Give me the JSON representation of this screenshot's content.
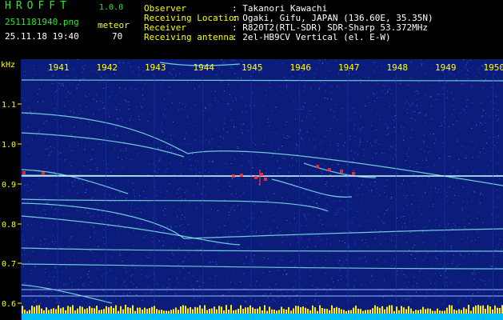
{
  "app": {
    "name": "HROFFT",
    "version": "1.0.0"
  },
  "file": {
    "name": "2511181940.png",
    "timestamp": "25.11.18 19:40"
  },
  "meteor": {
    "label": "meteor",
    "count": "70"
  },
  "info": [
    {
      "key": "Observer",
      "value": ": Takanori Kawachi"
    },
    {
      "key": "Receiving Location",
      "value": ": Ogaki, Gifu, JAPAN (136.60E, 35.35N)"
    },
    {
      "key": "Receiver",
      "value": ": R820T2(RTL-SDR) SDR-Sharp 53.372MHz"
    },
    {
      "key": "Receiving antenna",
      "value": ": 2el-HB9CV Vertical (el. E-W)"
    }
  ],
  "plot": {
    "unit_label": "kHz",
    "time_ticks": [
      "1941",
      "1942",
      "1943",
      "1944",
      "1945",
      "1946",
      "1947",
      "1948",
      "1949",
      "1950"
    ],
    "freq_ticks": [
      "1.1",
      "1.0",
      "0.9",
      "0.8",
      "0.7",
      "0.6"
    ],
    "colors": {
      "background": "#0b1c7a",
      "noise": "#3a6cff",
      "trace": "#7fe8e8",
      "echo": "#ff3030",
      "bars": "#ffee00",
      "baseline": "#00bfff"
    }
  }
}
